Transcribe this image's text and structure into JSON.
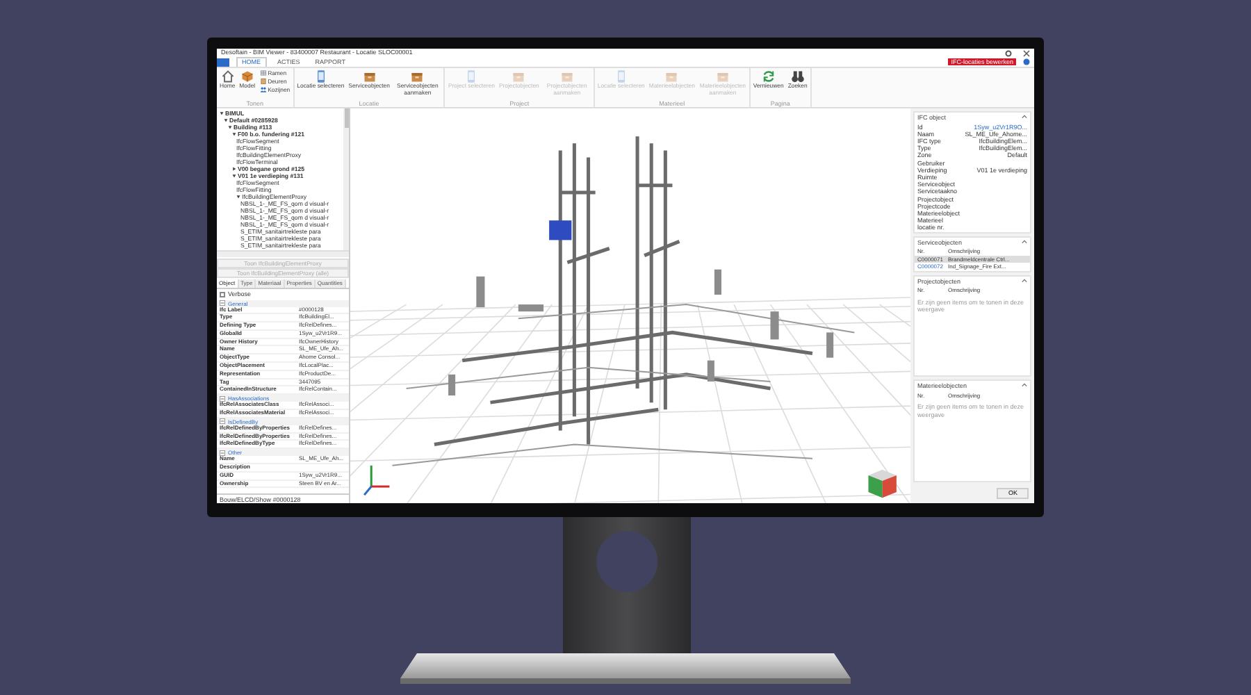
{
  "window": {
    "title": "Desoftain - BIM Viewer - 83400007 Restaurant - Locatie SLOC00001"
  },
  "ribbon_tabs": [
    {
      "label": "HOME",
      "selected": true
    },
    {
      "label": "ACTIES",
      "selected": false
    },
    {
      "label": "RAPPORT",
      "selected": false
    }
  ],
  "status_badge": "IFC-locaties bewerken",
  "ribbon_groups": [
    {
      "label": "Tonen",
      "buttons": [
        {
          "label": "Home",
          "disabled": false
        },
        {
          "label": "Model",
          "disabled": false
        },
        {
          "label": "Ramen",
          "disabled": false
        },
        {
          "label": "Deuren",
          "disabled": false
        },
        {
          "label": "Kozijnen",
          "disabled": false
        }
      ]
    },
    {
      "label": "Locatie",
      "buttons": [
        {
          "label": "Locatie selecteren",
          "disabled": false
        },
        {
          "label": "Serviceobjecten",
          "disabled": false
        },
        {
          "label": "Serviceobjecten aanmaken",
          "disabled": false
        }
      ]
    },
    {
      "label": "Project",
      "buttons": [
        {
          "label": "Project selecteren",
          "disabled": true
        },
        {
          "label": "Projectobjecten",
          "disabled": true
        },
        {
          "label": "Projectobjecten aanmaken",
          "disabled": true
        }
      ]
    },
    {
      "label": "Materieel",
      "buttons": [
        {
          "label": "Locatie selecteren",
          "disabled": true
        },
        {
          "label": "Materieelobjecten",
          "disabled": true
        },
        {
          "label": "Materieelobjecten aanmaken",
          "disabled": true
        }
      ]
    },
    {
      "label": "Pagina",
      "buttons": [
        {
          "label": "Vernieuwen",
          "disabled": false
        },
        {
          "label": "Zoeken",
          "disabled": false
        }
      ]
    }
  ],
  "tree": [
    {
      "label": "BIMUL",
      "expanded": true,
      "children": [
        {
          "label": "Default #0285928",
          "expanded": true,
          "children": [
            {
              "label": "Building #113",
              "expanded": true,
              "children": [
                {
                  "label": "F00 b.o. fundering #121",
                  "expanded": true,
                  "children": [
                    {
                      "label": "IfcFlowSegment"
                    },
                    {
                      "label": "IfcFlowFitting"
                    },
                    {
                      "label": "IfcBuildingElementProxy"
                    },
                    {
                      "label": "IfcFlowTerminal"
                    }
                  ]
                },
                {
                  "label": "V00 begane grond #125",
                  "expanded": false
                },
                {
                  "label": "V01 1e verdieping #131",
                  "expanded": true,
                  "children": [
                    {
                      "label": "IfcFlowSegment"
                    },
                    {
                      "label": "IfcFlowFitting"
                    },
                    {
                      "label": "IfcBuildingElementProxy",
                      "expanded": true,
                      "children": [
                        {
                          "label": "NBSL_1-_ME_FS_qom d visual-r"
                        },
                        {
                          "label": "NBSL_1-_ME_FS_qom d visual-r"
                        },
                        {
                          "label": "NBSL_1-_ME_FS_qom d visual-r"
                        },
                        {
                          "label": "NBSL_1-_ME_FS_qom d visual-r"
                        },
                        {
                          "label": "S_ETIM_sanitairtrekleste para"
                        },
                        {
                          "label": "S_ETIM_sanitairtrekleste para"
                        },
                        {
                          "label": "S_ETIM_sanitairtrekleste para"
                        }
                      ]
                    }
                  ]
                }
              ]
            }
          ]
        }
      ]
    }
  ],
  "tree_buttons": [
    {
      "label": "Toon IfcBuildingElementProxy",
      "disabled": true
    },
    {
      "label": "Toon IfcBuildingElementProxy (alle)",
      "disabled": true
    }
  ],
  "property_tabs": [
    {
      "label": "Object",
      "selected": true
    },
    {
      "label": "Type",
      "selected": false
    },
    {
      "label": "Materiaal",
      "selected": false
    },
    {
      "label": "Properties",
      "selected": false
    },
    {
      "label": "Quantities",
      "selected": false
    }
  ],
  "verbose": {
    "label": "Verbose",
    "checked": false
  },
  "property_sections": [
    {
      "title": "General",
      "expanded": true,
      "rows": [
        {
          "name": "Ifc Label",
          "value": "#0000128"
        },
        {
          "name": "Type",
          "value": "IfcBuildingEl..."
        },
        {
          "name": "Defining Type",
          "value": "IfcRelDefines..."
        },
        {
          "name": "GlobalId",
          "value": "1Syw_u2Vr1R9..."
        },
        {
          "name": "Owner History",
          "value": "IfcOwnerHistory"
        },
        {
          "name": "Name",
          "value": "SL_ME_Ufe_Ah..."
        },
        {
          "name": "ObjectType",
          "value": "Ahome Consol..."
        },
        {
          "name": "ObjectPlacement",
          "value": "IfcLocalPlac..."
        },
        {
          "name": "Representation",
          "value": "IfcProductDe..."
        },
        {
          "name": "Tag",
          "value": "3447095"
        },
        {
          "name": "ContainedInStructure",
          "value": "IfcRelContain..."
        }
      ]
    },
    {
      "title": "HasAssociations",
      "expanded": true,
      "rows": [
        {
          "name": "IfcRelAssociatesClass",
          "value": "IfcRelAssoci..."
        },
        {
          "name": "IfcRelAssociatesMaterial",
          "value": "IfcRelAssoci..."
        }
      ]
    },
    {
      "title": "IsDefinedBy",
      "expanded": true,
      "rows": [
        {
          "name": "IfcRelDefinedByProperties",
          "value": "IfcRelDefines..."
        },
        {
          "name": "IfcRelDefinedByProperties",
          "value": "IfcRelDefines..."
        },
        {
          "name": "IfcRelDefinedByType",
          "value": "IfcRelDefines..."
        }
      ]
    },
    {
      "title": "Other",
      "expanded": true,
      "rows": [
        {
          "name": "Name",
          "value": "SL_ME_Ufe_Ah..."
        },
        {
          "name": "Description"
        },
        {
          "name": "GUID",
          "value": "1Syw_u2Vr1R9..."
        },
        {
          "name": "Ownership",
          "value": "Steen BV en Ar..."
        }
      ]
    }
  ],
  "left_status": "Bouw/ELCD/Show #0000128",
  "ifc_object": {
    "title": "IFC object",
    "expanded": true,
    "fields": [
      {
        "label": "Id",
        "value": "1Syw_u2Vr1R9O...",
        "link": true
      },
      {
        "label": "Naam",
        "value": "SL_ME_Ufe_Ahome...",
        "link": false
      },
      {
        "label": "IFC type",
        "value": "IfcBuildingElem...",
        "link": false
      },
      {
        "label": "Type",
        "value": "IfcBuildingElem...",
        "link": false
      },
      {
        "label": "Zone",
        "value": "Default",
        "link": false
      },
      {
        "label": "Gebruiker"
      },
      {
        "label": "Verdieping",
        "value": "V01 1e verdieping",
        "link": false
      },
      {
        "label": "Ruimte"
      },
      {
        "label": "Serviceobject"
      },
      {
        "label": "Servicetaakno"
      },
      {
        "label": "Projectobject"
      },
      {
        "label": "Projectcode"
      },
      {
        "label": "Materieelobject"
      },
      {
        "label": "Materieel locatie nr."
      }
    ]
  },
  "object_lists": [
    {
      "title": "Serviceobjecten",
      "expanded": true,
      "columns": [
        "Nr.",
        "Omschrijving"
      ],
      "rows": [
        {
          "nr": "C0000071",
          "description": "Brandmeldcentrale Ctrl...",
          "selected": true
        },
        {
          "nr": "C0000072",
          "description": "Ind_Signage_Fire Ext...",
          "selected": false
        }
      ]
    },
    {
      "title": "Projectobjecten",
      "expanded": true,
      "columns": [
        "Nr.",
        "Omschrijving"
      ],
      "empty_message": "Er zijn geen items om te tonen in deze weergave"
    },
    {
      "title": "Materieelobjecten",
      "expanded": true,
      "columns": [
        "Nr.",
        "Omschrijving"
      ],
      "empty_message": "Er zijn geen items om te tonen in deze weergave"
    }
  ],
  "ok_button": "OK"
}
